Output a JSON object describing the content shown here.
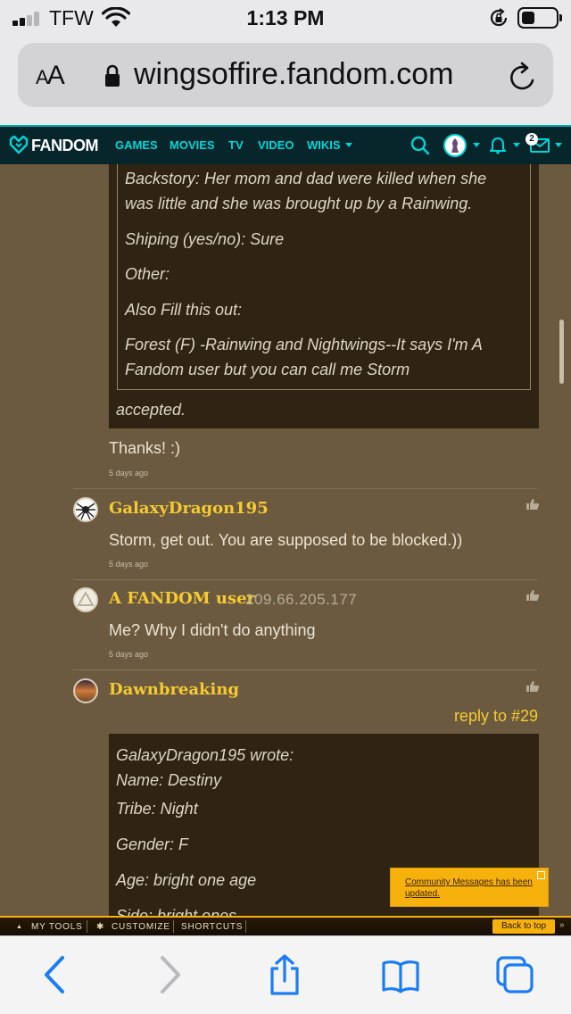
{
  "status_bar": {
    "carrier": "TFW",
    "time": "1:13 PM"
  },
  "browser": {
    "text_size_label": "AA",
    "url": "wingsoffire.fandom.com"
  },
  "fandom_nav": {
    "logo_text": "FANDOM",
    "links": [
      "GAMES",
      "MOVIES",
      "TV",
      "VIDEO",
      "WIKIS"
    ],
    "notification_count": "2",
    "accent_color": "#00d6d6"
  },
  "quote1": {
    "lines": [
      "Backstory: Her mom and dad were killed when she",
      "was little and she was brought up by a Rainwing.",
      "Shiping (yes/no): Sure",
      "Other:",
      "Also Fill this out:",
      "Forest (F) -Rainwing and Nightwings--It says I'm A",
      "Fandom user but you can call me Storm"
    ],
    "accepted": "accepted."
  },
  "comments": [
    {
      "username": "",
      "ip": "",
      "text": "Thanks! :)",
      "time": "5 days ago"
    },
    {
      "username": "GalaxyDragon195",
      "ip": "",
      "text": "Storm, get out. You are supposed to be blocked.))",
      "time": "5 days ago"
    },
    {
      "username": "A FANDOM user",
      "ip": "209.66.205.177",
      "text": "Me? Why I didn't do anything",
      "time": "5 days ago"
    },
    {
      "username": "Dawnbreaking",
      "ip": "",
      "text": "",
      "time": ""
    }
  ],
  "reply": {
    "label": "reply to #29",
    "quote_header": "GalaxyDragon195 wrote:",
    "quote_lines": [
      "Name: Destiny",
      "Tribe: Night",
      "Gender: F",
      "Age:  bright one age",
      "Side: bright ones"
    ]
  },
  "toast": {
    "text": "Community Messages has been updated."
  },
  "toolbar": {
    "my_tools": "MY TOOLS",
    "customize": "CUSTOMIZE",
    "shortcuts": "SHORTCUTS",
    "back_to_top": "Back to top"
  },
  "colors": {
    "username": "#f6cb31",
    "page_bg": "#6b5a40",
    "quote_bg": "#2f2414",
    "toolbar_accent": "#f6b10d",
    "safari_blue": "#1a7cf6"
  }
}
